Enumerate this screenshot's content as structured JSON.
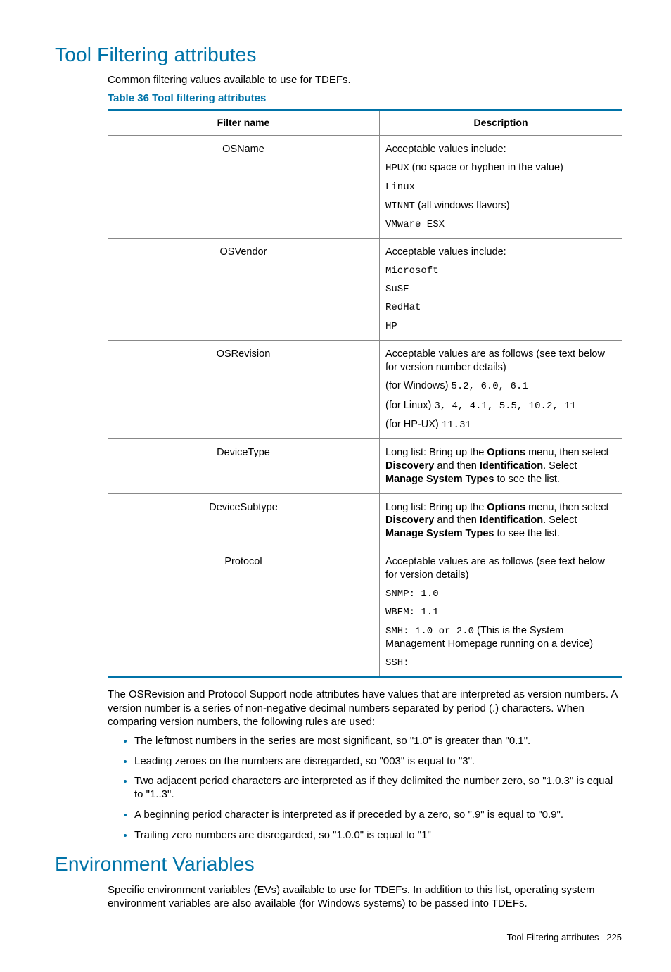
{
  "h1": "Tool Filtering attributes",
  "intro": "Common filtering values available to use for TDEFs.",
  "tableCaption": "Table 36 Tool filtering attributes",
  "thFilter": "Filter name",
  "thDesc": "Description",
  "rows": {
    "r0": {
      "name": "OSName",
      "p0": "Acceptable values include:",
      "p1a": "HPUX",
      "p1b": " (no space or hyphen in the value)",
      "p2": "Linux",
      "p3a": "WINNT",
      "p3b": " (all windows flavors)",
      "p4": "VMware ESX"
    },
    "r1": {
      "name": "OSVendor",
      "p0": "Acceptable values include:",
      "p1": "Microsoft",
      "p2": "SuSE",
      "p3": "RedHat",
      "p4": "HP"
    },
    "r2": {
      "name": "OSRevision",
      "p0": "Acceptable values are as follows (see text below for version number details)",
      "p1a": "(for Windows) ",
      "p1b": "5.2, 6.0, 6.1",
      "p2a": "(for Linux) ",
      "p2b": "3, 4, 4.1, 5.5, 10.2, 11",
      "p3a": "(for HP-UX) ",
      "p3b": "11.31"
    },
    "r3": {
      "name": "DeviceType",
      "p0a": "Long list: Bring up the ",
      "p0b": "Options",
      "p0c": " menu, then select ",
      "p0d": "Discovery",
      "p0e": " and then ",
      "p0f": "Identification",
      "p0g": ". Select ",
      "p0h": "Manage System Types",
      "p0i": " to see the list."
    },
    "r4": {
      "name": "DeviceSubtype",
      "p0a": "Long list: Bring up the ",
      "p0b": "Options",
      "p0c": " menu, then select ",
      "p0d": "Discovery",
      "p0e": " and then ",
      "p0f": "Identification",
      "p0g": ". Select ",
      "p0h": "Manage System Types",
      "p0i": " to see the list."
    },
    "r5": {
      "name": "Protocol",
      "p0": "Acceptable values are as follows (see text below for version details)",
      "p1": "SNMP: 1.0",
      "p2": "WBEM: 1.1",
      "p3a": "SMH: 1.0 or 2.0",
      "p3b": " (This is the System Management Homepage running on a device)",
      "p4": "SSH:"
    }
  },
  "bodyPara": "The OSRevision and Protocol Support node attributes have values that are interpreted as version numbers. A version number is a series of non-negative decimal numbers separated by period (.) characters. When comparing version numbers, the following rules are used:",
  "rules": {
    "li0": "The leftmost numbers in the series are most significant, so \"1.0\" is greater than \"0.1\".",
    "li1": "Leading zeroes on the numbers are disregarded, so \"003\" is equal to \"3\".",
    "li2": "Two adjacent period characters are interpreted as if they delimited the number zero, so \"1.0.3\" is equal to \"1..3\".",
    "li3": "A beginning period character is interpreted as if preceded by a zero, so \".9\" is equal to \"0.9\".",
    "li4": "Trailing zero numbers are disregarded, so \"1.0.0\" is equal to \"1\""
  },
  "h2": "Environment Variables",
  "envPara": "Specific environment variables (EVs) available to use for TDEFs. In addition to this list, operating system environment variables are also available (for Windows systems) to be passed into TDEFs.",
  "footerLabel": "Tool Filtering attributes",
  "footerPage": "225"
}
